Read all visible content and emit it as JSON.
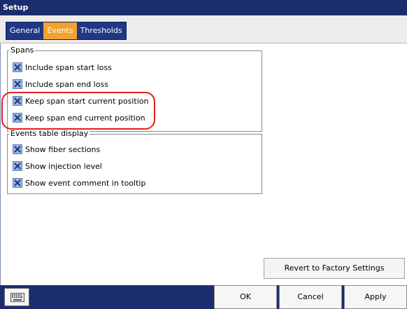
{
  "window": {
    "title": "Setup"
  },
  "tabs": [
    {
      "label": "General",
      "active": false
    },
    {
      "label": "Events",
      "active": true
    },
    {
      "label": "Thresholds",
      "active": false
    }
  ],
  "spans": {
    "legend": "Spans",
    "items": [
      {
        "label": "Include span start loss",
        "checked": true
      },
      {
        "label": "Include span end loss",
        "checked": true
      },
      {
        "label": "Keep span start current position",
        "checked": true
      },
      {
        "label": "Keep span end current position",
        "checked": true
      }
    ]
  },
  "events_table": {
    "legend": "Events table display",
    "items": [
      {
        "label": "Show fiber sections",
        "checked": true
      },
      {
        "label": "Show injection level",
        "checked": true
      },
      {
        "label": "Show event comment in tooltip",
        "checked": true
      }
    ]
  },
  "actions": {
    "revert_label": "Revert to Factory Settings",
    "ok_label": "OK",
    "cancel_label": "Cancel",
    "apply_label": "Apply"
  },
  "colors": {
    "titlebar": "#1c2d6e",
    "active_tab": "#f2a22e",
    "callout": "#e02020"
  },
  "icons": {
    "checkbox_mark": "x-mark-icon",
    "keyboard": "keyboard-icon"
  }
}
